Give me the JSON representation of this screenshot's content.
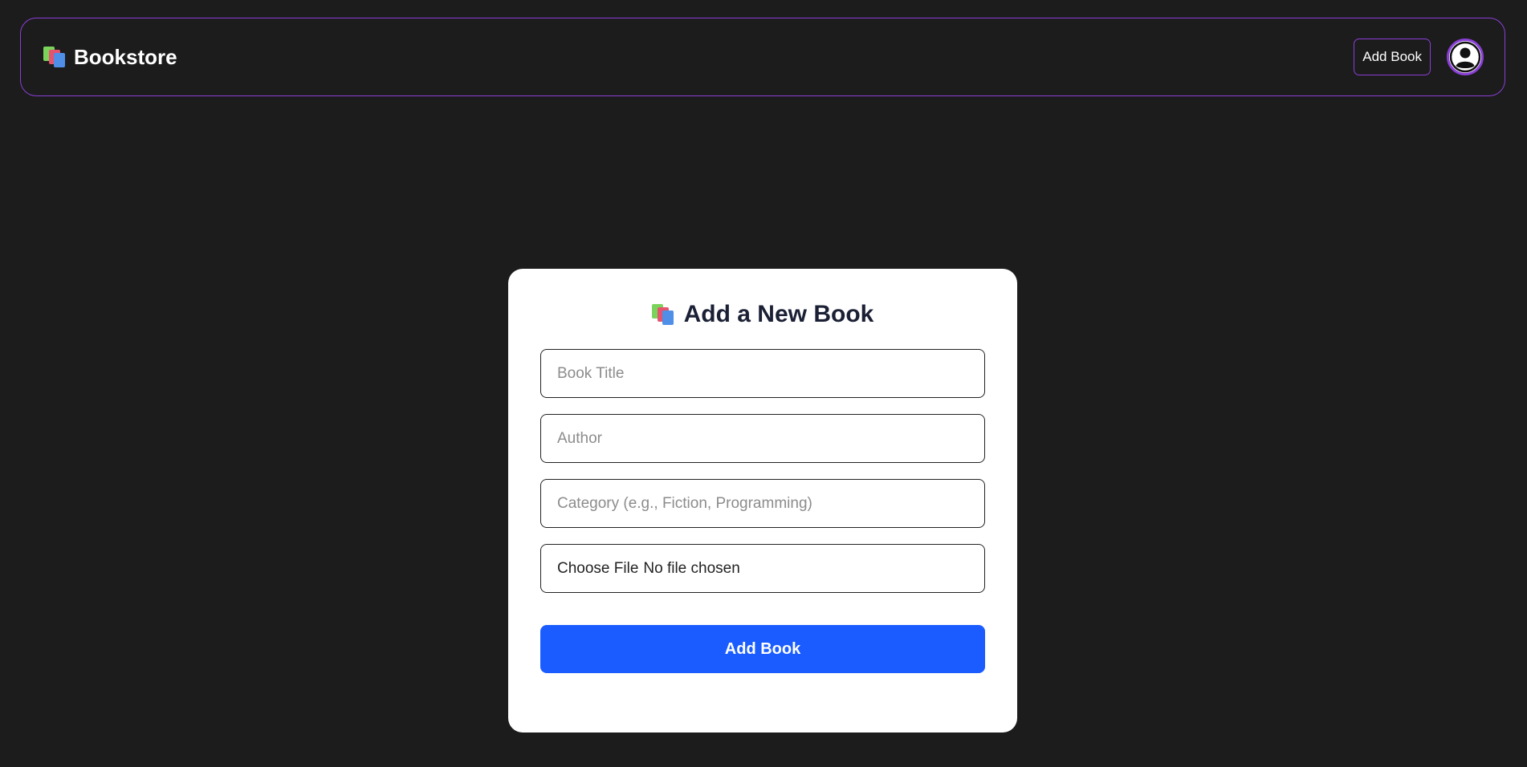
{
  "navbar": {
    "brand": "Bookstore",
    "brand_icon": "books-icon",
    "add_book_label": "Add Book",
    "avatar_icon": "user-avatar-icon"
  },
  "form": {
    "title": "Add a New Book",
    "title_icon": "books-icon",
    "title_placeholder": "Book Title",
    "author_placeholder": "Author",
    "category_placeholder": "Category (e.g., Fiction, Programming)",
    "file_button": "Choose File",
    "file_status": "No file chosen",
    "submit_label": "Add Book"
  },
  "colors": {
    "background": "#1c1c1c",
    "accent_border": "#8a3fd6",
    "primary_button": "#1a5cff",
    "title_text": "#1b2035"
  }
}
